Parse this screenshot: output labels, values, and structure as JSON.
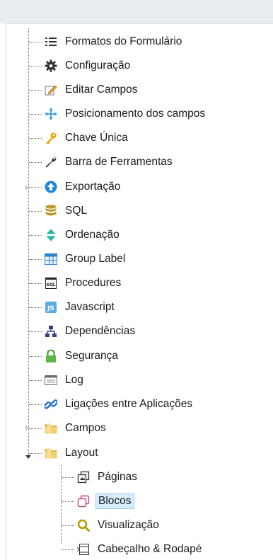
{
  "tree": {
    "items": [
      {
        "label": "Formatos do Formulário",
        "icon": "list-icon"
      },
      {
        "label": "Configuração",
        "icon": "gear-icon"
      },
      {
        "label": "Editar Campos",
        "icon": "edit-icon"
      },
      {
        "label": "Posicionamento dos campos",
        "icon": "move-arrows-icon"
      },
      {
        "label": "Chave Única",
        "icon": "key-icon"
      },
      {
        "label": "Barra de Ferramentas",
        "icon": "wrench-icon"
      },
      {
        "label": "Exportação",
        "icon": "upload-circle-icon"
      },
      {
        "label": "SQL",
        "icon": "database-icon"
      },
      {
        "label": "Ordenação",
        "icon": "sort-arrows-icon"
      },
      {
        "label": "Group Label",
        "icon": "table-grid-icon"
      },
      {
        "label": "Procedures",
        "icon": "sql-file-icon"
      },
      {
        "label": "Javascript",
        "icon": "javascript-icon"
      },
      {
        "label": "Dependências",
        "icon": "hierarchy-icon"
      },
      {
        "label": "Segurança",
        "icon": "lock-icon"
      },
      {
        "label": "Log",
        "icon": "log-window-icon"
      },
      {
        "label": "Ligações entre Aplicações",
        "icon": "link-icon"
      },
      {
        "label": "Campos",
        "icon": "folder-icon"
      },
      {
        "label": "Layout",
        "icon": "folder-icon"
      }
    ],
    "layout_children": [
      {
        "label": "Páginas",
        "icon": "pages-icon"
      },
      {
        "label": "Blocos",
        "icon": "blocks-icon",
        "selected": true
      },
      {
        "label": "Visualização",
        "icon": "magnifier-icon"
      },
      {
        "label": "Cabeçalho & Rodapé",
        "icon": "header-footer-icon"
      }
    ]
  },
  "colors": {
    "selection_bg": "#d6ecfb",
    "accent_blue": "#1e88d8"
  }
}
